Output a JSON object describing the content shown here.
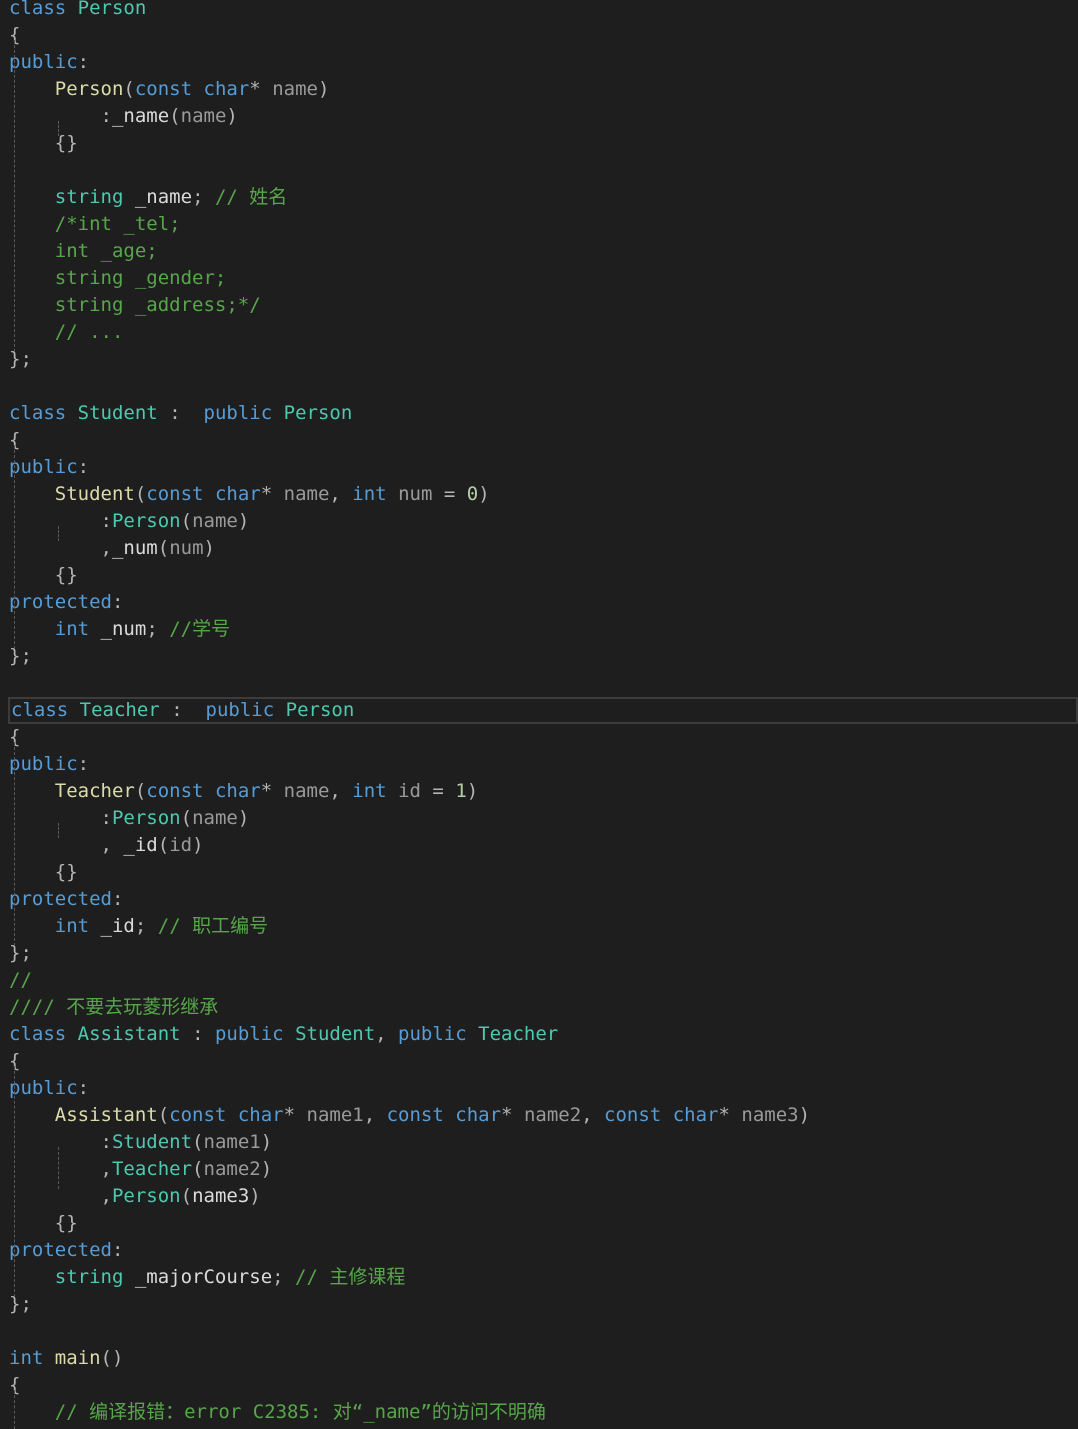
{
  "editor": {
    "theme_colors": {
      "background": "#1e1e1e",
      "keyword": "#569cd6",
      "type": "#4ec9b0",
      "function": "#dcdcaa",
      "comment": "#57a64a",
      "plain": "#dcdcdc"
    },
    "lines": [
      [
        [
          "kw",
          "class"
        ],
        [
          "tx",
          " "
        ],
        [
          "ty",
          "Person"
        ]
      ],
      [
        [
          "pn",
          "{"
        ]
      ],
      [
        [
          "kw",
          "public"
        ],
        [
          "pn",
          ":"
        ]
      ],
      [
        [
          "tx",
          "    "
        ],
        [
          "fn",
          "Person"
        ],
        [
          "pn",
          "("
        ],
        [
          "kw",
          "const"
        ],
        [
          "tx",
          " "
        ],
        [
          "kw",
          "char"
        ],
        [
          "pn",
          "*"
        ],
        [
          "tx",
          " "
        ],
        [
          "pa",
          "name"
        ],
        [
          "pn",
          ")"
        ]
      ],
      [
        [
          "tx",
          "        "
        ],
        [
          "pn",
          ":"
        ],
        [
          "mem",
          "_name"
        ],
        [
          "pn",
          "("
        ],
        [
          "pa",
          "name"
        ],
        [
          "pn",
          ")"
        ]
      ],
      [
        [
          "tx",
          "    "
        ],
        [
          "pn",
          "{}"
        ]
      ],
      [],
      [
        [
          "tx",
          "    "
        ],
        [
          "ty",
          "string"
        ],
        [
          "tx",
          " "
        ],
        [
          "mem",
          "_name"
        ],
        [
          "pn",
          ";"
        ],
        [
          "tx",
          " "
        ],
        [
          "cm",
          "// 姓名"
        ]
      ],
      [
        [
          "tx",
          "    "
        ],
        [
          "cm",
          "/*int _tel;"
        ]
      ],
      [
        [
          "tx",
          "    "
        ],
        [
          "cm",
          "int _age;"
        ]
      ],
      [
        [
          "tx",
          "    "
        ],
        [
          "cm",
          "string _gender;"
        ]
      ],
      [
        [
          "tx",
          "    "
        ],
        [
          "cm",
          "string _address;*/"
        ]
      ],
      [
        [
          "tx",
          "    "
        ],
        [
          "cm",
          "// ..."
        ]
      ],
      [
        [
          "pn",
          "};"
        ]
      ],
      [],
      [
        [
          "kw",
          "class"
        ],
        [
          "tx",
          " "
        ],
        [
          "ty",
          "Student"
        ],
        [
          "tx",
          " "
        ],
        [
          "pn",
          ":"
        ],
        [
          "tx",
          "  "
        ],
        [
          "kw",
          "public"
        ],
        [
          "tx",
          " "
        ],
        [
          "ty",
          "Person"
        ]
      ],
      [
        [
          "pn",
          "{"
        ]
      ],
      [
        [
          "kw",
          "public"
        ],
        [
          "pn",
          ":"
        ]
      ],
      [
        [
          "tx",
          "    "
        ],
        [
          "fn",
          "Student"
        ],
        [
          "pn",
          "("
        ],
        [
          "kw",
          "const"
        ],
        [
          "tx",
          " "
        ],
        [
          "kw",
          "char"
        ],
        [
          "pn",
          "*"
        ],
        [
          "tx",
          " "
        ],
        [
          "pa",
          "name"
        ],
        [
          "pn",
          ","
        ],
        [
          "tx",
          " "
        ],
        [
          "kw",
          "int"
        ],
        [
          "tx",
          " "
        ],
        [
          "pa",
          "num"
        ],
        [
          "tx",
          " "
        ],
        [
          "pn",
          "="
        ],
        [
          "tx",
          " "
        ],
        [
          "nu",
          "0"
        ],
        [
          "pn",
          ")"
        ]
      ],
      [
        [
          "tx",
          "        "
        ],
        [
          "pn",
          ":"
        ],
        [
          "ty",
          "Person"
        ],
        [
          "pn",
          "("
        ],
        [
          "pa",
          "name"
        ],
        [
          "pn",
          ")"
        ]
      ],
      [
        [
          "tx",
          "        "
        ],
        [
          "pn",
          ","
        ],
        [
          "mem",
          "_num"
        ],
        [
          "pn",
          "("
        ],
        [
          "pa",
          "num"
        ],
        [
          "pn",
          ")"
        ]
      ],
      [
        [
          "tx",
          "    "
        ],
        [
          "pn",
          "{}"
        ]
      ],
      [
        [
          "kw",
          "protected"
        ],
        [
          "pn",
          ":"
        ]
      ],
      [
        [
          "tx",
          "    "
        ],
        [
          "kw",
          "int"
        ],
        [
          "tx",
          " "
        ],
        [
          "mem",
          "_num"
        ],
        [
          "pn",
          ";"
        ],
        [
          "tx",
          " "
        ],
        [
          "cm",
          "//学号"
        ]
      ],
      [
        [
          "pn",
          "};"
        ]
      ],
      [],
      [
        [
          "kw",
          "class"
        ],
        [
          "tx",
          " "
        ],
        [
          "ty",
          "Teacher"
        ],
        [
          "tx",
          " "
        ],
        [
          "pn",
          ":"
        ],
        [
          "tx",
          "  "
        ],
        [
          "kw",
          "public"
        ],
        [
          "tx",
          " "
        ],
        [
          "ty",
          "Person"
        ]
      ],
      [
        [
          "pn",
          "{"
        ]
      ],
      [
        [
          "kw",
          "public"
        ],
        [
          "pn",
          ":"
        ]
      ],
      [
        [
          "tx",
          "    "
        ],
        [
          "fn",
          "Teacher"
        ],
        [
          "pn",
          "("
        ],
        [
          "kw",
          "const"
        ],
        [
          "tx",
          " "
        ],
        [
          "kw",
          "char"
        ],
        [
          "pn",
          "*"
        ],
        [
          "tx",
          " "
        ],
        [
          "pa",
          "name"
        ],
        [
          "pn",
          ","
        ],
        [
          "tx",
          " "
        ],
        [
          "kw",
          "int"
        ],
        [
          "tx",
          " "
        ],
        [
          "pa",
          "id"
        ],
        [
          "tx",
          " "
        ],
        [
          "pn",
          "="
        ],
        [
          "tx",
          " "
        ],
        [
          "nu",
          "1"
        ],
        [
          "pn",
          ")"
        ]
      ],
      [
        [
          "tx",
          "        "
        ],
        [
          "pn",
          ":"
        ],
        [
          "ty",
          "Person"
        ],
        [
          "pn",
          "("
        ],
        [
          "pa",
          "name"
        ],
        [
          "pn",
          ")"
        ]
      ],
      [
        [
          "tx",
          "        "
        ],
        [
          "pn",
          ","
        ],
        [
          "tx",
          " "
        ],
        [
          "mem",
          "_id"
        ],
        [
          "pn",
          "("
        ],
        [
          "pa",
          "id"
        ],
        [
          "pn",
          ")"
        ]
      ],
      [
        [
          "tx",
          "    "
        ],
        [
          "pn",
          "{}"
        ]
      ],
      [
        [
          "kw",
          "protected"
        ],
        [
          "pn",
          ":"
        ]
      ],
      [
        [
          "tx",
          "    "
        ],
        [
          "kw",
          "int"
        ],
        [
          "tx",
          " "
        ],
        [
          "mem",
          "_id"
        ],
        [
          "pn",
          ";"
        ],
        [
          "tx",
          " "
        ],
        [
          "cm",
          "// 职工编号"
        ]
      ],
      [
        [
          "pn",
          "};"
        ]
      ],
      [
        [
          "cm",
          "//"
        ]
      ],
      [
        [
          "cm",
          "//// 不要去玩菱形继承"
        ]
      ],
      [
        [
          "kw",
          "class"
        ],
        [
          "tx",
          " "
        ],
        [
          "ty",
          "Assistant"
        ],
        [
          "tx",
          " "
        ],
        [
          "pn",
          ":"
        ],
        [
          "tx",
          " "
        ],
        [
          "kw",
          "public"
        ],
        [
          "tx",
          " "
        ],
        [
          "ty",
          "Student"
        ],
        [
          "pn",
          ","
        ],
        [
          "tx",
          " "
        ],
        [
          "kw",
          "public"
        ],
        [
          "tx",
          " "
        ],
        [
          "ty",
          "Teacher"
        ]
      ],
      [
        [
          "pn",
          "{"
        ]
      ],
      [
        [
          "kw",
          "public"
        ],
        [
          "pn",
          ":"
        ]
      ],
      [
        [
          "tx",
          "    "
        ],
        [
          "fn",
          "Assistant"
        ],
        [
          "pn",
          "("
        ],
        [
          "kw",
          "const"
        ],
        [
          "tx",
          " "
        ],
        [
          "kw",
          "char"
        ],
        [
          "pn",
          "*"
        ],
        [
          "tx",
          " "
        ],
        [
          "pa",
          "name1"
        ],
        [
          "pn",
          ","
        ],
        [
          "tx",
          " "
        ],
        [
          "kw",
          "const"
        ],
        [
          "tx",
          " "
        ],
        [
          "kw",
          "char"
        ],
        [
          "pn",
          "*"
        ],
        [
          "tx",
          " "
        ],
        [
          "pa",
          "name2"
        ],
        [
          "pn",
          ","
        ],
        [
          "tx",
          " "
        ],
        [
          "kw",
          "const"
        ],
        [
          "tx",
          " "
        ],
        [
          "kw",
          "char"
        ],
        [
          "pn",
          "*"
        ],
        [
          "tx",
          " "
        ],
        [
          "pa",
          "name3"
        ],
        [
          "pn",
          ")"
        ]
      ],
      [
        [
          "tx",
          "        "
        ],
        [
          "pn",
          ":"
        ],
        [
          "ty",
          "Student"
        ],
        [
          "pn",
          "("
        ],
        [
          "pa",
          "name1"
        ],
        [
          "pn",
          ")"
        ]
      ],
      [
        [
          "tx",
          "        "
        ],
        [
          "pn",
          ","
        ],
        [
          "ty",
          "Teacher"
        ],
        [
          "pn",
          "("
        ],
        [
          "pa",
          "name2"
        ],
        [
          "pn",
          ")"
        ]
      ],
      [
        [
          "tx",
          "        "
        ],
        [
          "pn",
          ","
        ],
        [
          "ty",
          "Person"
        ],
        [
          "pn",
          "("
        ],
        [
          "tx",
          "name3"
        ],
        [
          "pn",
          ")"
        ]
      ],
      [
        [
          "tx",
          "    "
        ],
        [
          "pn",
          "{}"
        ]
      ],
      [
        [
          "kw",
          "protected"
        ],
        [
          "pn",
          ":"
        ]
      ],
      [
        [
          "tx",
          "    "
        ],
        [
          "ty",
          "string"
        ],
        [
          "tx",
          " "
        ],
        [
          "mem",
          "_majorCourse"
        ],
        [
          "pn",
          ";"
        ],
        [
          "tx",
          " "
        ],
        [
          "cm",
          "// 主修课程"
        ]
      ],
      [
        [
          "pn",
          "};"
        ]
      ],
      [],
      [
        [
          "kw",
          "int"
        ],
        [
          "tx",
          " "
        ],
        [
          "fn",
          "main"
        ],
        [
          "pn",
          "()"
        ]
      ],
      [
        [
          "pn",
          "{"
        ]
      ],
      [
        [
          "tx",
          "    "
        ],
        [
          "cm",
          "// 编译报错：error C2385: 对“_name”的访问不明确"
        ]
      ]
    ]
  }
}
